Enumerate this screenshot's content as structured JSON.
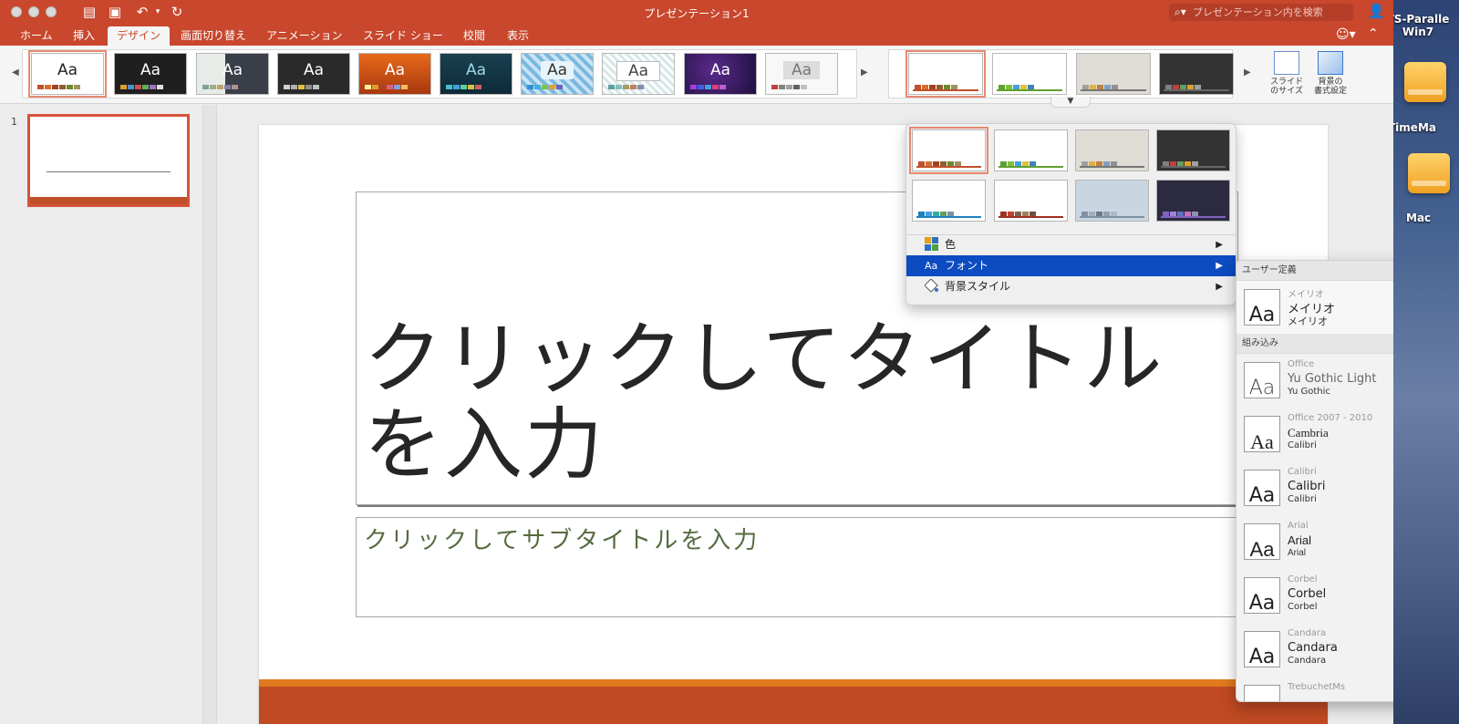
{
  "window": {
    "title": "プレゼンテーション1",
    "search_placeholder": "プレゼンテーション内を検索"
  },
  "desktop": {
    "icons": [
      {
        "label_line1": "TS-Paralle",
        "label_line2": "Win7"
      },
      {
        "label": "TimeMa"
      },
      {
        "label": "Mac"
      }
    ]
  },
  "tabs": [
    {
      "label": "ホーム"
    },
    {
      "label": "挿入"
    },
    {
      "label": "デザイン",
      "active": true
    },
    {
      "label": "画面切り替え"
    },
    {
      "label": "アニメーション"
    },
    {
      "label": "スライド ショー"
    },
    {
      "label": "校閲"
    },
    {
      "label": "表示"
    }
  ],
  "ribbon": {
    "theme_sample_text": "Aa",
    "slide_size": {
      "line1": "スライド",
      "line2": "のサイズ"
    },
    "background_format": {
      "line1": "背景の",
      "line2": "書式設定"
    }
  },
  "thumbnails": {
    "slide_number": "1"
  },
  "slide": {
    "title_placeholder": "クリックしてタイトルを入力",
    "subtitle_placeholder": "クリックしてサブタイトルを入力"
  },
  "variant_menu": {
    "items": [
      {
        "label": "色",
        "icon": "color-grid-icon"
      },
      {
        "label": "フォント",
        "icon": "font-aa-icon",
        "highlighted": true
      },
      {
        "label": "背景スタイル",
        "icon": "paint-bucket-icon"
      }
    ]
  },
  "font_menu": {
    "section_custom": "ユーザー定義",
    "custom": [
      {
        "name": "メイリオ",
        "heading": "メイリオ",
        "body": "メイリオ"
      }
    ],
    "section_builtin": "組み込み",
    "builtin": [
      {
        "name": "Office",
        "heading": "Yu Gothic Light",
        "body": "Yu Gothic"
      },
      {
        "name": "Office 2007 - 2010",
        "heading": "Cambria",
        "body": "Calibri"
      },
      {
        "name": "Calibri",
        "heading": "Calibri",
        "body": "Calibri"
      },
      {
        "name": "Arial",
        "heading": "Arial",
        "body": "Arial"
      },
      {
        "name": "Corbel",
        "heading": "Corbel",
        "body": "Corbel"
      },
      {
        "name": "Candara",
        "heading": "Candara",
        "body": "Candara"
      },
      {
        "name": "TrebuchetMs",
        "heading": "",
        "body": ""
      }
    ],
    "sample_text": "Aa"
  },
  "colors": {
    "accent": "#c8472d",
    "menu_highlight": "#0c4bc1",
    "slide_band": "#c04a22"
  }
}
